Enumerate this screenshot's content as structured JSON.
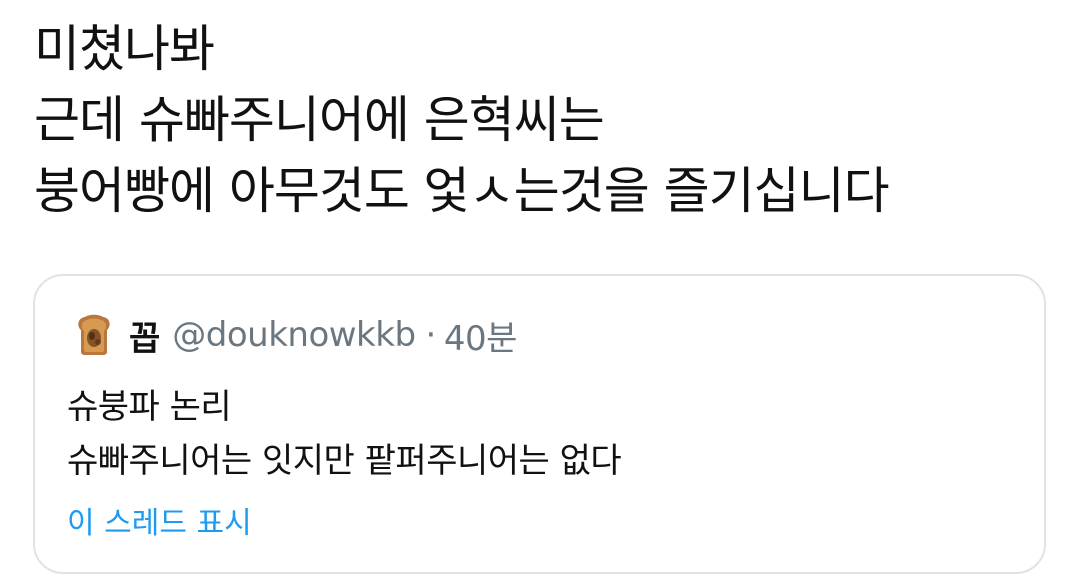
{
  "tweet": {
    "lines": [
      "미쳤나봐",
      "근데 슈빠주니어에 은혁씨는",
      "붕어빵에 아무것도 엋ㅅ는것을 즐기십니다"
    ]
  },
  "quoted_tweet": {
    "avatar_icon": "toast-bread-icon",
    "author_name": "꼽",
    "author_handle": "@douknowkkb",
    "separator": "·",
    "time_ago": "40분",
    "lines": [
      "슈붕파 논리",
      "슈빠주니어는 잇지만 팥퍼주니어는 없다"
    ],
    "show_thread_label": "이 스레드 표시",
    "colors": {
      "link": "#1d9bf0",
      "secondary_text": "#6b7780",
      "border": "#dfe3e6"
    }
  }
}
